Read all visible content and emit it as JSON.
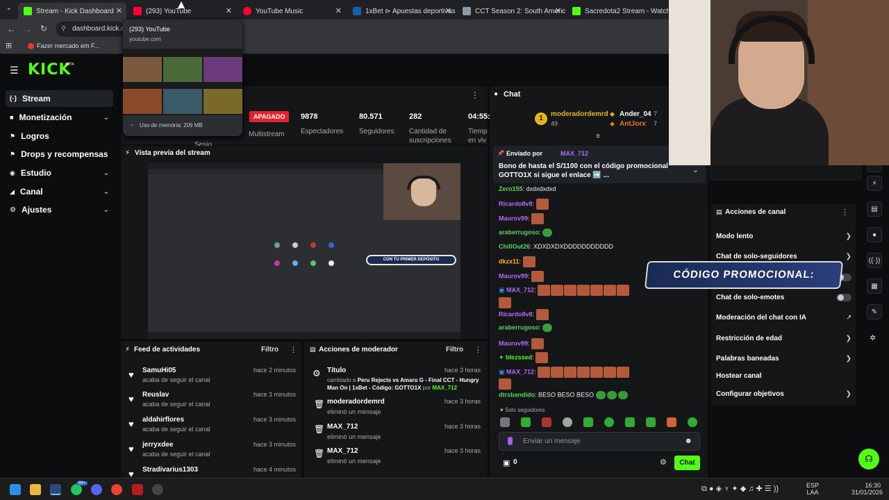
{
  "browser": {
    "tabs": [
      {
        "label": "Stream - Kick Dashboard",
        "color": "#53fc18"
      },
      {
        "label": "(293) YouTube",
        "color": "#ff0033"
      },
      {
        "label": "YouTube Music",
        "color": "#ff0033"
      },
      {
        "label": "1xBet ⊳ Apuestas deportivas o",
        "color": "#1a5ea8"
      },
      {
        "label": "CCT Season 2: South America S",
        "color": "#8899aa"
      },
      {
        "label": "Sacredota2 Stream - Watch Liv",
        "color": "#53fc18"
      }
    ],
    "address": "dashboard.kick.co",
    "bookmark": "Fazer mercado em F...",
    "hover_card": {
      "title": "(293) YouTube",
      "domain": "youtube.com",
      "memory": "Uso de memória: 209 MB"
    }
  },
  "kick": {
    "logo": "KICK",
    "logo_badge": "BETA",
    "sidebar": [
      {
        "label": "Stream",
        "icon": "(·)",
        "chevron": false
      },
      {
        "label": "Monetización",
        "icon": "■",
        "chevron": true
      },
      {
        "label": "Logros",
        "icon": "🏆",
        "chevron": false
      },
      {
        "label": "Drops y recompensas",
        "icon": "🏆",
        "chevron": false
      },
      {
        "label": "Estudio",
        "icon": "◉",
        "chevron": true
      },
      {
        "label": "Canal",
        "icon": "◢",
        "chevron": true
      },
      {
        "label": "Ajustes",
        "icon": "⚙",
        "chevron": true
      }
    ],
    "stats": {
      "status": "APAGADO",
      "multistream": "Multistream",
      "items": [
        {
          "value": "9878",
          "label": "Espectadores"
        },
        {
          "value": "80.571",
          "label": "Seguidores"
        },
        {
          "value": "282",
          "label": "Cantidad de suscripciones"
        },
        {
          "value": "04:55:",
          "label": "Tiemp en viv"
        }
      ],
      "partial_label": "Sesio"
    },
    "preview": {
      "title": "Vista previa del stream",
      "promo_text": "CON TU PRIMER DEPÓSITO"
    },
    "feed": {
      "title": "Feed de actividades",
      "filter": "Filtro",
      "items": [
        {
          "name": "SamuHi05",
          "sub": "acaba de seguir el canal",
          "time": "hace 2 minutos"
        },
        {
          "name": "Reuslav",
          "sub": "acaba de seguir el canal",
          "time": "hace 3 minutos"
        },
        {
          "name": "aldahirflores",
          "sub": "acaba de seguir el canal",
          "time": "hace 3 minutos"
        },
        {
          "name": "jerryxdee",
          "sub": "acaba de seguir el canal",
          "time": "hace 3 minutos"
        },
        {
          "name": "Stradivarius1303",
          "sub": "",
          "time": "hace 4 minutos"
        }
      ]
    },
    "modactions": {
      "title": "Acciones de moderador",
      "filter": "Filtro",
      "items": [
        {
          "name": "Título",
          "sub1": "cambiado a ",
          "sub_bold": "Peru Rejects vs Amaru G - Final CCT - Hungry Man On | 1xBet - Código: GOTTO1X",
          "sub2": " por ",
          "sub_user": "MAX_712",
          "time": "hace 3 horas"
        },
        {
          "name": "moderadordemrd",
          "sub": "eliminó un mensaje",
          "time": "hace 3 horas"
        },
        {
          "name": "MAX_712",
          "sub": "eliminó un mensaje",
          "time": "hace 3 horas"
        },
        {
          "name": "MAX_712",
          "sub": "eliminó un mensaje",
          "time": "hace 3 horas"
        }
      ]
    },
    "chat": {
      "title": "Chat",
      "leaderboard": [
        {
          "rank": "1",
          "name": "moderadordemrd",
          "count": "49"
        },
        {
          "name": "Ander_04",
          "count": "7"
        },
        {
          "name": "AntJorx",
          "count": "7"
        }
      ],
      "pinned": {
        "by": "Enviado por",
        "user": "MAX_712",
        "text": "Bono de hasta el S/1100 con el código promocional GOTTO1X si sigue el enlace ➡️ ..."
      },
      "messages": [
        {
          "user": "Zero155",
          "color": "#5bd15b",
          "text": ": dxdxdxdxd"
        },
        {
          "user": "Ricardo8v8",
          "color": "#b06bff",
          "text": ":"
        },
        {
          "user": "Maurov99",
          "color": "#b06bff",
          "text": ":"
        },
        {
          "user": "araberrugoso",
          "color": "#5bd15b",
          "text": ":"
        },
        {
          "user": "ChillOut26",
          "color": "#5bd15b",
          "text": ": XDXDXDXDDDDDDDDDDD"
        },
        {
          "user": "dkzx11",
          "color": "#ffb020",
          "text": ":"
        },
        {
          "user": "Maurov99",
          "color": "#b06bff",
          "text": ":"
        },
        {
          "user": "MAX_712",
          "color": "#b06bff",
          "text": ":"
        },
        {
          "user": "Ricardo8v8",
          "color": "#b06bff",
          "text": ":"
        },
        {
          "user": "araberrugoso",
          "color": "#5bd15b",
          "text": ":"
        },
        {
          "user": "Maurov99",
          "color": "#b06bff",
          "text": ":"
        },
        {
          "user": "blezssed",
          "color": "#53fc18",
          "text": ":"
        },
        {
          "user": "MAX_712",
          "color": "#b06bff",
          "text": ":"
        },
        {
          "user": "dtrsbandido",
          "color": "#5bd15b",
          "text": ": BESO BESO BESO"
        }
      ],
      "followers_only": "Solo seguidores",
      "input_placeholder": "Enviar un mensaje",
      "points": "0",
      "send": "Chat"
    },
    "channel_actions": {
      "title": "Acciones de canal",
      "items": [
        {
          "label": "Modo lento",
          "type": "chevron"
        },
        {
          "label": "Chat de solo-seguidores",
          "type": "chevron"
        },
        {
          "label": "",
          "type": "toggle"
        },
        {
          "label": "Chat de solo-emotes",
          "type": "toggle"
        },
        {
          "label": "Moderación del chat con IA",
          "type": "external"
        },
        {
          "label": "Restricción de edad",
          "type": "chevron"
        },
        {
          "label": "Palabras baneadas",
          "type": "chevron"
        },
        {
          "label": "Hostear canal",
          "type": "none"
        },
        {
          "label": "Configurar objetivos",
          "type": "chevron"
        }
      ]
    },
    "overlay_promo": "CÓDIGO PROMOCIONAL:"
  },
  "taskbar": {
    "lang": "ESP",
    "region": "LAA",
    "time": "16:30",
    "date": "31/01/2026",
    "badge": "99+"
  }
}
